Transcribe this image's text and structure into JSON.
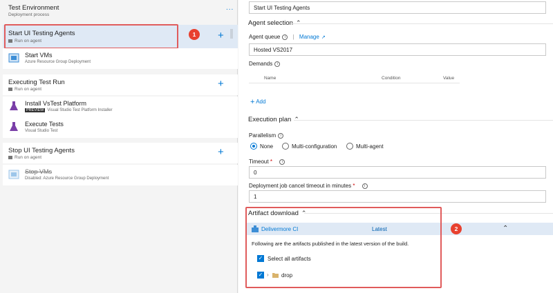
{
  "environment": {
    "title": "Test Environment",
    "subtitle": "Deployment process",
    "more": "..."
  },
  "phases": [
    {
      "title": "Start UI Testing Agents",
      "subtitle": "Run on agent"
    },
    {
      "title": "Executing Test Run",
      "subtitle": "Run on agent"
    },
    {
      "title": "Stop UI Testing Agents",
      "subtitle": "Run on agent"
    }
  ],
  "tasks": [
    {
      "title": "Start VMs",
      "subtitle": "Azure Resource Group Deployment"
    },
    {
      "title": "Install VsTest Platform",
      "badge": "PREVIEW",
      "subtitle": "Visual Studio Test Platform Installer"
    },
    {
      "title": "Execute Tests",
      "subtitle": "Visual Studio Test"
    },
    {
      "title": "Stop VMs",
      "subtitle": "Disabled: Azure Resource Group Deployment"
    }
  ],
  "annotations": {
    "one": "1",
    "two": "2"
  },
  "right": {
    "display_name": "Start UI Testing Agents",
    "agent_selection": "Agent selection",
    "agent_queue_label": "Agent queue",
    "separator": "|",
    "manage": "Manage",
    "agent_queue_value": "Hosted VS2017",
    "demands_label": "Demands",
    "col_name": "Name",
    "col_condition": "Condition",
    "col_value": "Value",
    "add": "Add",
    "execution_plan": "Execution plan",
    "parallelism_label": "Parallelism",
    "radio_none": "None",
    "radio_multi_config": "Multi-configuration",
    "radio_multi_agent": "Multi-agent",
    "timeout_label": "Timeout",
    "timeout_value": "0",
    "cancel_timeout_label": "Deployment job cancel timeout in minutes",
    "cancel_timeout_value": "1",
    "required_mark": "*",
    "artifact_download": "Artifact download",
    "artifact_name": "Delivermore CI",
    "artifact_version": "Latest",
    "artifact_desc": "Following are the artifacts published in the latest version of the build.",
    "select_all": "Select all artifacts",
    "drop": "drop"
  },
  "colors": {
    "accent": "#0078d4",
    "highlight": "#e05b5b",
    "badge": "#e8412f",
    "selected": "#dfe9f5"
  }
}
